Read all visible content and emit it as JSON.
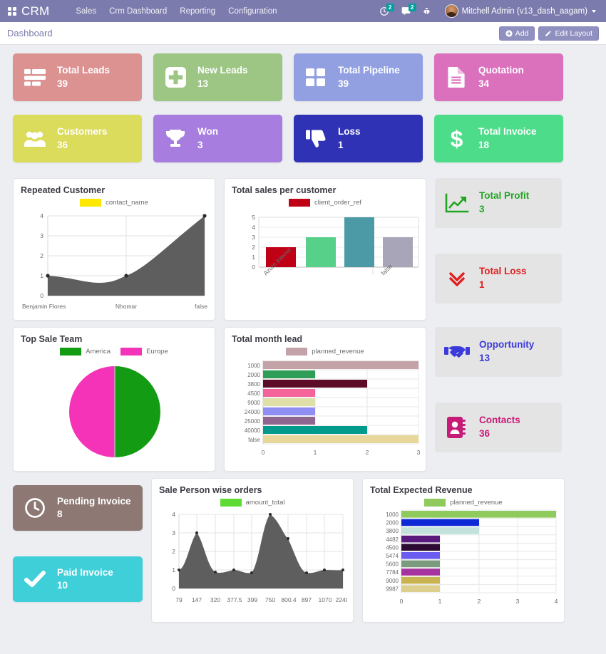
{
  "navbar": {
    "apps_icon": "apps-grid-icon",
    "brand": "CRM",
    "menu": [
      {
        "label": "Sales"
      },
      {
        "label": "Crm Dashboard"
      },
      {
        "label": "Reporting"
      },
      {
        "label": "Configuration"
      }
    ],
    "activities_icon": "clock-activity-icon",
    "activities_badge": "2",
    "messages_icon": "chat-bubble-icon",
    "messages_badge": "2",
    "debug_icon": "bug-debug-icon",
    "user_name": "Mitchell Admin (v13_dash_aagam)",
    "accent": "#7c7bad",
    "badge_color": "#00a09d"
  },
  "control_panel": {
    "breadcrumb": "Dashboard",
    "add_label": "Add",
    "edit_layout_label": "Edit Layout"
  },
  "kpis_row1": [
    {
      "title": "Total Leads",
      "value": "39",
      "color": "#dd9292",
      "icon": "list-icon"
    },
    {
      "title": "New Leads",
      "value": "13",
      "color": "#9dc684",
      "icon": "plus-square-icon"
    },
    {
      "title": "Total Pipeline",
      "value": "39",
      "color": "#92a0e2",
      "icon": "grid-squares-icon"
    },
    {
      "title": "Quotation",
      "value": "34",
      "color": "#db70bd",
      "icon": "document-icon"
    }
  ],
  "kpis_row2": [
    {
      "title": "Customers",
      "value": "36",
      "color": "#dbdb5c",
      "icon": "users-icon"
    },
    {
      "title": "Won",
      "value": "3",
      "color": "#a универс",
      "icon": "trophy-icon"
    },
    {
      "title": "Loss",
      "value": "1",
      "color": "#2f32b5",
      "icon": "thumbs-down-icon"
    },
    {
      "title": "Total Invoice",
      "value": "18",
      "color": "#4ddd8a",
      "icon": "dollar-icon"
    }
  ],
  "kpi_won_color": "#a77de0",
  "kpis_bottom": [
    {
      "title": "Pending Invoice",
      "value": "8",
      "color": "#8d7873",
      "icon": "clock-icon"
    },
    {
      "title": "Paid Invoice",
      "value": "10",
      "color": "#3ecfd9",
      "icon": "check-icon"
    }
  ],
  "side_stats": [
    {
      "title": "Total Profit",
      "value": "3",
      "color": "#22a522",
      "icon": "chart-up-icon"
    },
    {
      "title": "Total Loss",
      "value": "1",
      "color": "#e02020",
      "icon": "double-chevron-down-icon"
    },
    {
      "title": "Opportunity",
      "value": "13",
      "color": "#3b3bdc",
      "icon": "handshake-icon"
    },
    {
      "title": "Contacts",
      "value": "36",
      "color": "#c61c77",
      "icon": "contact-book-icon"
    }
  ],
  "chart_data": [
    {
      "id": "repeated_customer",
      "type": "area",
      "title": "Repeated Customer",
      "legend": [
        {
          "name": "contact_name",
          "color": "#ffe800"
        }
      ],
      "legend_position": "top",
      "series_color": "#5e5e5e",
      "x": [
        "Benjamin Flores",
        "Nhomar",
        "false"
      ],
      "categories": [
        "Benjamin Flores",
        "Nhomar",
        "false"
      ],
      "values": [
        1,
        1,
        4
      ],
      "yticks": [
        0,
        1,
        2,
        3,
        4
      ],
      "ylim": [
        0,
        4
      ],
      "xlabel": "",
      "ylabel": "",
      "grid": true
    },
    {
      "id": "total_sales_per_customer",
      "type": "bar",
      "title": "Total sales per customer",
      "legend": [
        {
          "name": "client_order_ref",
          "color": "#c00014"
        }
      ],
      "legend_position": "top",
      "categories": [
        "Azure Interior",
        "",
        "",
        "false"
      ],
      "values": [
        2,
        3,
        5,
        3
      ],
      "bar_colors": [
        "#c00014",
        "#57d18a",
        "#4b9aa6",
        "#a8a5b8"
      ],
      "yticks": [
        0,
        1,
        2,
        3,
        4,
        5
      ],
      "ylim": [
        0,
        5
      ],
      "xlabel": "",
      "ylabel": "",
      "grid": true
    },
    {
      "id": "top_sale_team",
      "type": "pie",
      "title": "Top Sale Team",
      "legend_position": "top",
      "labels": [
        "America",
        "Europe"
      ],
      "values": [
        50,
        50
      ],
      "colors": [
        "#139c13",
        "#f433b8"
      ]
    },
    {
      "id": "total_month_lead",
      "type": "bar",
      "orientation": "horizontal",
      "title": "Total month lead",
      "legend": [
        {
          "name": "planned_revenue",
          "color": "#c3a3a8"
        }
      ],
      "legend_position": "top",
      "categories": [
        "1000",
        "2000",
        "3800",
        "4500",
        "9000",
        "24000",
        "25000",
        "40000",
        "false"
      ],
      "values": [
        3,
        1,
        2,
        1,
        1,
        1,
        1,
        2,
        3
      ],
      "bar_colors": [
        "#c3a3a8",
        "#2f9e58",
        "#5c0c26",
        "#f4649a",
        "#dfe0a8",
        "#8f8ef2",
        "#8f6690",
        "#009b8c",
        "#e8d79a"
      ],
      "xticks": [
        0,
        1,
        2,
        3
      ],
      "xlim": [
        0,
        3
      ],
      "xlabel": "",
      "ylabel": "",
      "grid": true
    },
    {
      "id": "sale_person_wise_orders",
      "type": "area",
      "title": "Sale Person wise orders",
      "legend": [
        {
          "name": "amount_total",
          "color": "#5fdb35"
        }
      ],
      "legend_position": "top",
      "series_color": "#5e5e5e",
      "categories": [
        "79",
        "147",
        "320",
        "377.5",
        "399",
        "750",
        "800.4",
        "897",
        "1070",
        "2240"
      ],
      "values": [
        1,
        3,
        1,
        1,
        1,
        4,
        3,
        1,
        1,
        1
      ],
      "yticks": [
        0,
        1,
        2,
        3,
        4
      ],
      "ylim": [
        0,
        4
      ],
      "xlabel": "",
      "ylabel": "",
      "grid": true
    },
    {
      "id": "total_expected_revenue",
      "type": "bar",
      "orientation": "horizontal",
      "title": "Total Expected Revenue",
      "legend": [
        {
          "name": "planned_revenue",
          "color": "#8fca5c"
        }
      ],
      "legend_position": "top",
      "categories": [
        "1000",
        "2000",
        "3800",
        "4482",
        "4500",
        "5474",
        "5600",
        "7784",
        "9000",
        "9987"
      ],
      "values": [
        4,
        2,
        2,
        1,
        1,
        1,
        1,
        1,
        1,
        1
      ],
      "bar_colors": [
        "#8fca5c",
        "#0f28d6",
        "#c3e2dc",
        "#59197d",
        "#2c0a33",
        "#6a5cf0",
        "#7c9b7e",
        "#a6329f",
        "#c9b350",
        "#ddd08f"
      ],
      "xticks": [
        0,
        1,
        2,
        3,
        4
      ],
      "xlim": [
        0,
        4
      ],
      "xlabel": "",
      "ylabel": "",
      "grid": true
    }
  ]
}
